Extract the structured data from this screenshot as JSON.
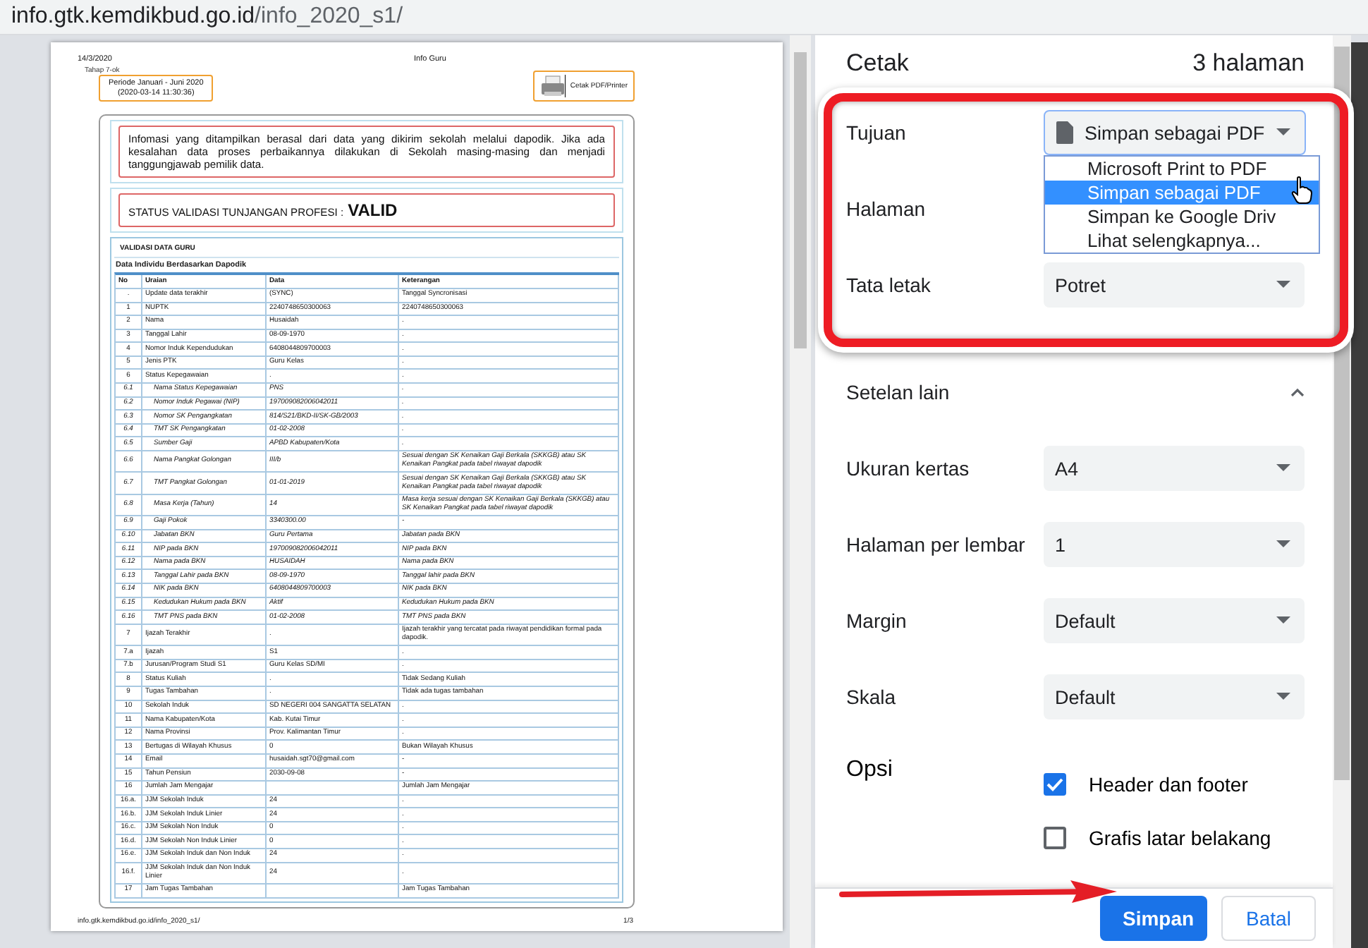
{
  "address_bar": {
    "host": "info.gtk.kemdikbud.go.id",
    "path": "/info_2020_s1/"
  },
  "preview": {
    "date": "14/3/2020",
    "title": "Info Guru",
    "stage": "Tahap 7-ok",
    "period": [
      "Periode Januari - Juni 2020",
      "(2020-03-14 11:30:36)"
    ],
    "print_button": "Cetak PDF/Printer",
    "notice": "Infomasi yang ditampilkan berasal dari data yang dikirim sekolah melalui dapodik. Jika ada kesalahan data proses perbaikannya dilakukan di Sekolah masing-masing dan menjadi tanggungjawab pemilik data.",
    "status": {
      "label": "STATUS VALIDASI TUNJANGAN PROFESI :",
      "value": "VALID"
    },
    "section_title": "VALIDASI DATA GURU",
    "table_title": "Data Individu Berdasarkan Dapodik",
    "table": {
      "columns": [
        "No",
        "Uraian",
        "Data",
        "Keterangan"
      ],
      "rows": [
        {
          "kind": "main",
          "no": ".",
          "item": "Update data terakhir",
          "data": "(SYNC)",
          "note": "Tanggal Syncronisasi"
        },
        {
          "kind": "main",
          "no": "1",
          "item": "NUPTK",
          "data": "2240748650300063",
          "note": "2240748650300063"
        },
        {
          "kind": "main",
          "no": "2",
          "item": "Nama",
          "data": "Husaidah",
          "note": "."
        },
        {
          "kind": "main",
          "no": "3",
          "item": "Tanggal Lahir",
          "data": "08-09-1970",
          "note": "."
        },
        {
          "kind": "main",
          "no": "4",
          "item": "Nomor Induk Kependudukan",
          "data": "6408044809700003",
          "note": "."
        },
        {
          "kind": "main",
          "no": "5",
          "item": "Jenis PTK",
          "data": "Guru Kelas",
          "note": "."
        },
        {
          "kind": "main",
          "no": "6",
          "item": "Status Kepegawaian",
          "data": ".",
          "note": "."
        },
        {
          "kind": "sub",
          "no": "6.1",
          "item": "Nama Status Kepegawaian",
          "data": "PNS",
          "note": "."
        },
        {
          "kind": "sub",
          "no": "6.2",
          "item": "Nomor Induk Pegawai (NIP)",
          "data": "197009082006042011",
          "note": "."
        },
        {
          "kind": "sub",
          "no": "6.3",
          "item": "Nomor SK Pengangkatan",
          "data": "814/S21/BKD-II/SK-GB/2003",
          "note": "."
        },
        {
          "kind": "sub",
          "no": "6.4",
          "item": "TMT SK Pengangkatan",
          "data": "01-02-2008",
          "note": "."
        },
        {
          "kind": "sub",
          "no": "6.5",
          "item": "Sumber Gaji",
          "data": "APBD Kabupaten/Kota",
          "note": "."
        },
        {
          "kind": "sub",
          "no": "6.6",
          "item": "Nama Pangkat Golongan",
          "data": "III/b",
          "note": "Sesuai dengan SK Kenaikan Gaji Berkala (SKKGB) atau SK Kenaikan Pangkat pada tabel riwayat dapodik"
        },
        {
          "kind": "sub",
          "no": "6.7",
          "item": "TMT Pangkat Golongan",
          "data": "01-01-2019",
          "note": "Sesuai dengan SK Kenaikan Gaji Berkala (SKKGB) atau SK Kenaikan Pangkat pada tabel riwayat dapodik"
        },
        {
          "kind": "sub",
          "no": "6.8",
          "item": "Masa Kerja (Tahun)",
          "data": "14",
          "note": "Masa kerja sesuai dengan SK Kenaikan Gaji Berkala (SKKGB) atau SK Kenaikan Pangkat pada tabel riwayat dapodik"
        },
        {
          "kind": "sub",
          "no": "6.9",
          "item": "Gaji Pokok",
          "data": "3340300.00",
          "note": "-"
        },
        {
          "kind": "sub",
          "no": "6.10",
          "item": "Jabatan BKN",
          "data": "Guru Pertama",
          "note": "Jabatan pada BKN"
        },
        {
          "kind": "sub",
          "no": "6.11",
          "item": "NIP pada BKN",
          "data": "197009082006042011",
          "note": "NIP pada BKN"
        },
        {
          "kind": "sub",
          "no": "6.12",
          "item": "Nama pada BKN",
          "data": "HUSAIDAH",
          "note": "Nama pada BKN"
        },
        {
          "kind": "sub",
          "no": "6.13",
          "item": "Tanggal Lahir pada BKN",
          "data": "08-09-1970",
          "note": "Tanggal lahir pada BKN"
        },
        {
          "kind": "sub",
          "no": "6.14",
          "item": "NIK pada BKN",
          "data": "6408044809700003",
          "note": "NIK pada BKN"
        },
        {
          "kind": "sub",
          "no": "6.15",
          "item": "Kedudukan Hukum pada BKN",
          "data": "Aktif",
          "note": "Kedudukan Hukum pada BKN"
        },
        {
          "kind": "sub",
          "no": "6.16",
          "item": "TMT PNS pada BKN",
          "data": "01-02-2008",
          "note": "TMT PNS pada BKN"
        },
        {
          "kind": "main",
          "no": "7",
          "item": "Ijazah Terakhir",
          "data": ".",
          "note": "Ijazah terakhir yang tercatat pada riwayat pendidikan formal pada dapodik."
        },
        {
          "kind": "main",
          "no": "7.a",
          "item": "Ijazah",
          "data": "S1",
          "note": "."
        },
        {
          "kind": "main",
          "no": "7.b",
          "item": "Jurusan/Program Studi S1",
          "data": "Guru Kelas SD/MI",
          "note": "."
        },
        {
          "kind": "main",
          "no": "8",
          "item": "Status Kuliah",
          "data": ".",
          "note": "Tidak Sedang Kuliah"
        },
        {
          "kind": "main",
          "no": "9",
          "item": "Tugas Tambahan",
          "data": ".",
          "note": "Tidak ada tugas tambahan"
        },
        {
          "kind": "main",
          "no": "10",
          "item": "Sekolah Induk",
          "data": "SD NEGERI 004 SANGATTA SELATAN",
          "note": "."
        },
        {
          "kind": "main",
          "no": "11",
          "item": "Nama Kabupaten/Kota",
          "data": "Kab. Kutai Timur",
          "note": "."
        },
        {
          "kind": "main",
          "no": "12",
          "item": "Nama Provinsi",
          "data": "Prov. Kalimantan Timur",
          "note": "."
        },
        {
          "kind": "main",
          "no": "13",
          "item": "Bertugas di Wilayah Khusus",
          "data": "0",
          "note": "Bukan Wilayah Khusus"
        },
        {
          "kind": "main",
          "no": "14",
          "item": "Email",
          "data": "husaidah.sgt70@gmail.com",
          "note": "-"
        },
        {
          "kind": "main",
          "no": "15",
          "item": "Tahun Pensiun",
          "data": "2030-09-08",
          "note": "-"
        },
        {
          "kind": "main",
          "no": "16",
          "item": "Jumlah Jam Mengajar",
          "note": "Jumlah Jam Mengajar"
        },
        {
          "kind": "main",
          "no": "16.a.",
          "item": "JJM Sekolah Induk",
          "data": "24",
          "note": "."
        },
        {
          "kind": "main",
          "no": "16.b.",
          "item": "JJM Sekolah Induk Linier",
          "data": "24",
          "note": "."
        },
        {
          "kind": "main",
          "no": "16.c.",
          "item": "JJM Sekolah Non Induk",
          "data": "0",
          "note": "."
        },
        {
          "kind": "main",
          "no": "16.d.",
          "item": "JJM Sekolah Non Induk Linier",
          "data": "0",
          "note": "."
        },
        {
          "kind": "main",
          "no": "16.e.",
          "item": "JJM Sekolah Induk dan Non Induk",
          "data": "24",
          "note": "."
        },
        {
          "kind": "main",
          "no": "16.f.",
          "item": "JJM Sekolah Induk dan Non Induk Linier",
          "data": "24",
          "note": "."
        },
        {
          "kind": "main",
          "no": "17",
          "item": "Jam Tugas Tambahan",
          "note": "Jam Tugas Tambahan"
        }
      ]
    },
    "footer_url": "info.gtk.kemdikbud.go.id/info_2020_s1/",
    "page_number": "1/3"
  },
  "print_panel": {
    "title": "Cetak",
    "page_count": "3 halaman",
    "settings": [
      {
        "kind": "destination",
        "label": "Tujuan",
        "value": "Simpan sebagai PDF",
        "expanded": true,
        "options": [
          {
            "label": "Microsoft Print to PDF",
            "selected": false
          },
          {
            "label": "Simpan sebagai PDF",
            "selected": true
          },
          {
            "label": "Simpan ke Google Driv",
            "selected": false
          },
          {
            "label": "Lihat selengkapnya...",
            "selected": false
          }
        ]
      },
      {
        "kind": "label",
        "label": "Halaman"
      },
      {
        "kind": "select",
        "label": "Tata letak",
        "value": "Potret"
      },
      {
        "kind": "section",
        "label": "Setelan lain",
        "expanded": true
      },
      {
        "kind": "select",
        "label": "Ukuran kertas",
        "value": "A4"
      },
      {
        "kind": "select",
        "label": "Halaman per lembar",
        "value": "1"
      },
      {
        "kind": "select",
        "label": "Margin",
        "value": "Default"
      },
      {
        "kind": "select",
        "label": "Skala",
        "value": "Default"
      },
      {
        "kind": "checkbox",
        "label": "Opsi",
        "options": [
          {
            "label": "Header dan footer",
            "checked": true
          },
          {
            "label": "Grafis latar belakang",
            "checked": false
          }
        ]
      }
    ],
    "buttons": [
      {
        "kind": "primary",
        "label": "Simpan"
      },
      {
        "kind": "secondary",
        "label": "Batal"
      }
    ]
  }
}
